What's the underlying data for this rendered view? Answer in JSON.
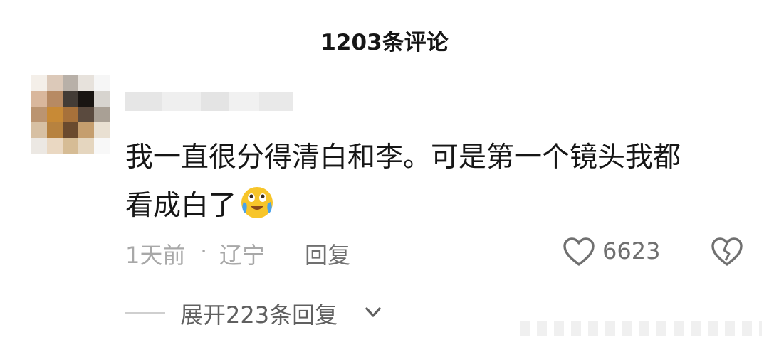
{
  "header": {
    "title": "1203条评论"
  },
  "comment": {
    "text_line_1": "我一直很分得清白和李。可是第一个镜头我都",
    "text_line_2": "看成白了",
    "emoji": "crying-laughing-emoji",
    "time": "1天前",
    "separator": "·",
    "location": "辽宁",
    "reply_label": "回复",
    "like_count": "6623",
    "like_icon": "heart-outline-icon",
    "dislike_icon": "broken-heart-icon"
  },
  "expand": {
    "label": "展开223条回复",
    "icon": "chevron-down-icon"
  },
  "colors": {
    "text_primary": "#161616",
    "text_secondary": "#a8a8a8",
    "text_action": "#707070",
    "emoji_face": "#f7c52a"
  }
}
